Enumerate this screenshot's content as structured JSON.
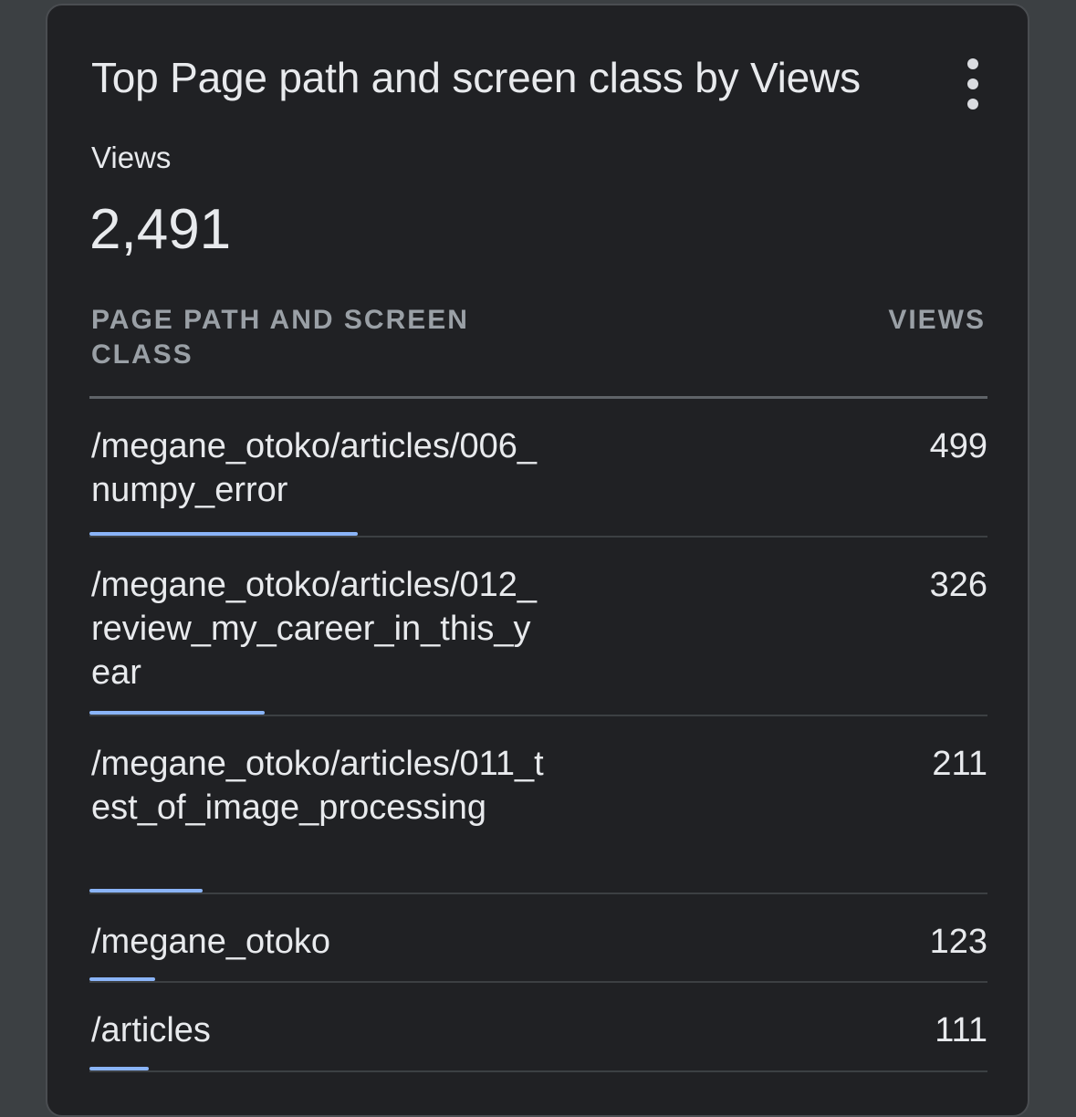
{
  "card": {
    "title": "Top Page path and screen class by Views",
    "more_icon": "more-vert-icon",
    "metric_label": "Views",
    "metric_value": "2,491"
  },
  "table": {
    "col_dimension": "PAGE PATH AND SCREEN CLASS",
    "col_metric": "VIEWS",
    "bar_color": "#8ab4f8",
    "max_value": 499,
    "rows": [
      {
        "path": "/megane_otoko/articles/006_numpy_error",
        "views": "499",
        "value": 499
      },
      {
        "path": "/megane_otoko/articles/012_review_my_career_in_this_year",
        "views": "326",
        "value": 326
      },
      {
        "path": "/megane_otoko/articles/011_test_of_image_processing",
        "views": "211",
        "value": 211
      },
      {
        "path": "/megane_otoko",
        "views": "123",
        "value": 123
      },
      {
        "path": "/articles",
        "views": "111",
        "value": 111
      }
    ]
  }
}
